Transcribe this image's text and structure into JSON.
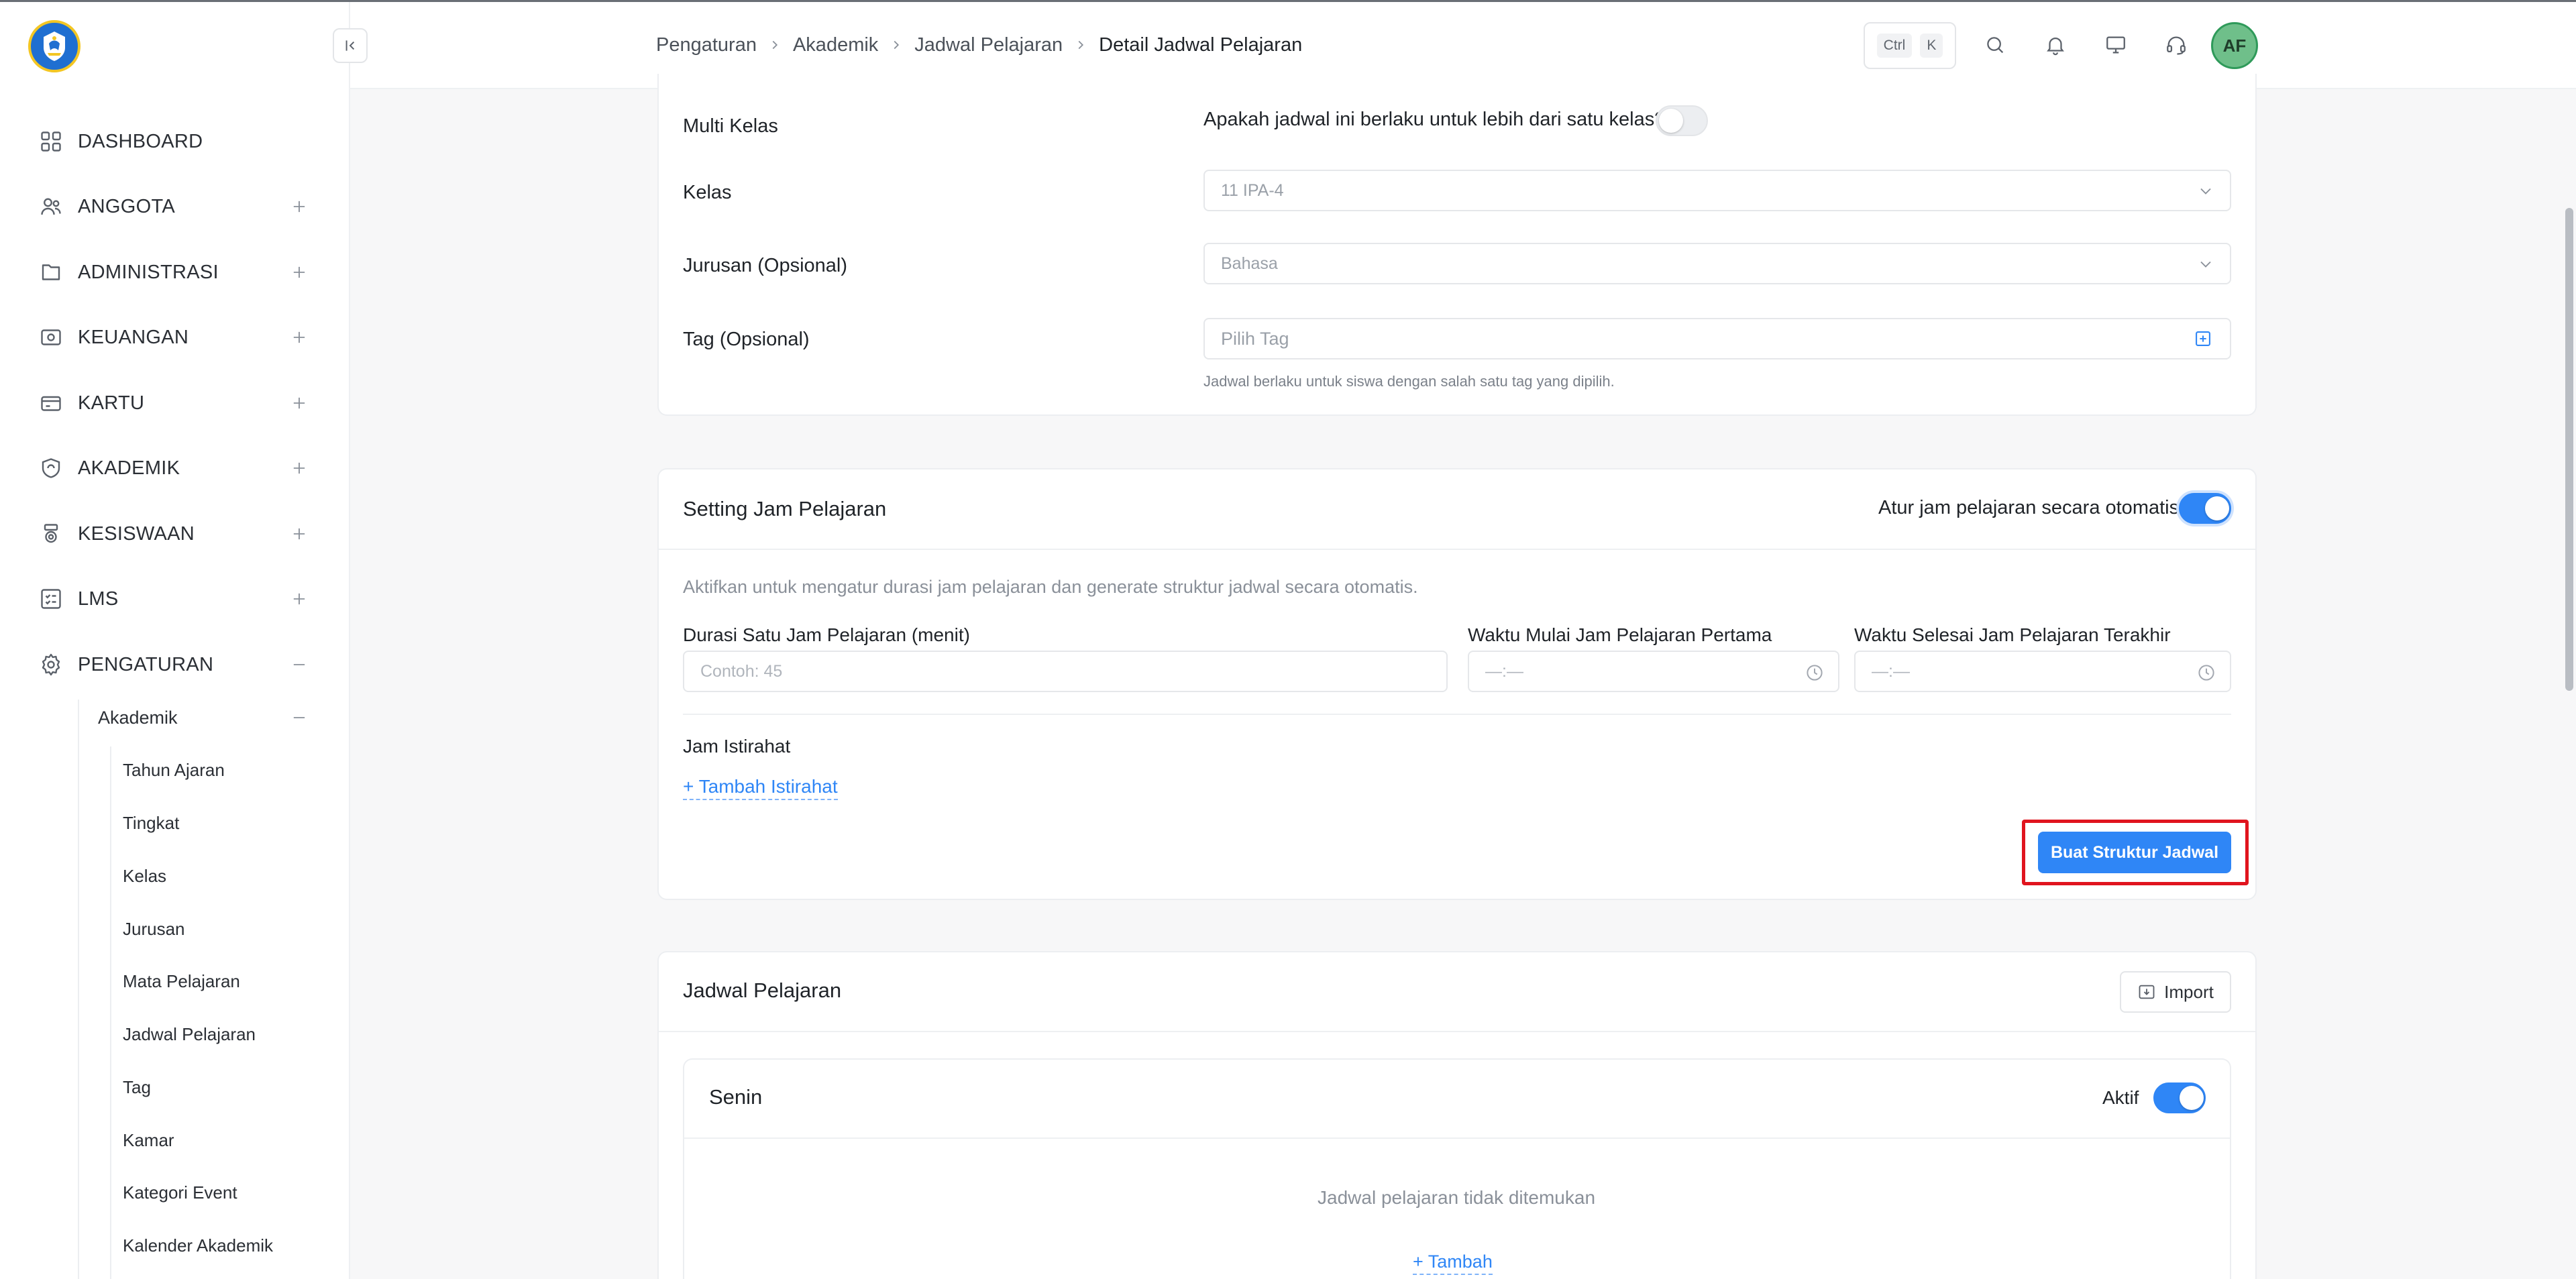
{
  "header": {
    "breadcrumb": [
      "Pengaturan",
      "Akademik",
      "Jadwal Pelajaran",
      "Detail Jadwal Pelajaran"
    ],
    "shortcut": {
      "ctrl": "Ctrl",
      "key": "K"
    },
    "avatar_initials": "AF"
  },
  "sidebar": {
    "items": [
      {
        "label": "DASHBOARD",
        "icon": "grid-icon"
      },
      {
        "label": "ANGGOTA",
        "icon": "users-icon"
      },
      {
        "label": "ADMINISTRASI",
        "icon": "folder-icon"
      },
      {
        "label": "KEUANGAN",
        "icon": "money-icon"
      },
      {
        "label": "KARTU",
        "icon": "card-icon"
      },
      {
        "label": "AKADEMIK",
        "icon": "badge-icon"
      },
      {
        "label": "KESISWAAN",
        "icon": "medal-icon"
      },
      {
        "label": "LMS",
        "icon": "list-check-icon"
      },
      {
        "label": "PENGATURAN",
        "icon": "gear-icon"
      }
    ],
    "submenu_title": "Akademik",
    "submenu_items": [
      "Tahun Ajaran",
      "Tingkat",
      "Kelas",
      "Jurusan",
      "Mata Pelajaran",
      "Jadwal Pelajaran",
      "Tag",
      "Kamar",
      "Kategori Event",
      "Kalender Akademik"
    ]
  },
  "general": {
    "multi_kelas_label": "Multi Kelas",
    "multi_kelas_question": "Apakah jadwal ini berlaku untuk lebih dari satu kelas?",
    "multi_kelas_on": false,
    "kelas_label": "Kelas",
    "kelas_value": "11 IPA-4",
    "jurusan_label": "Jurusan (Opsional)",
    "jurusan_value": "Bahasa",
    "tag_label": "Tag (Opsional)",
    "tag_placeholder": "Pilih Tag",
    "tag_help": "Jadwal berlaku untuk siswa dengan salah satu tag yang dipilih."
  },
  "setting": {
    "title": "Setting Jam Pelajaran",
    "auto_label": "Atur jam pelajaran secara otomatis",
    "auto_on": true,
    "description": "Aktifkan untuk mengatur durasi jam pelajaran dan generate struktur jadwal secara otomatis.",
    "durasi_label": "Durasi Satu Jam Pelajaran (menit)",
    "durasi_placeholder": "Contoh: 45",
    "mulai_label": "Waktu Mulai Jam Pelajaran Pertama",
    "mulai_placeholder": "—:—",
    "selesai_label": "Waktu Selesai Jam Pelajaran Terakhir",
    "selesai_placeholder": "—:—",
    "istirahat_label": "Jam Istirahat",
    "add_istirahat": "+ Tambah Istirahat",
    "generate_button": "Buat Struktur Jadwal"
  },
  "jadwal": {
    "title": "Jadwal Pelajaran",
    "import_label": "Import",
    "day": "Senin",
    "active_label": "Aktif",
    "active_on": true,
    "empty_text": "Jadwal pelajaran tidak ditemukan",
    "add_label": "+ Tambah"
  }
}
